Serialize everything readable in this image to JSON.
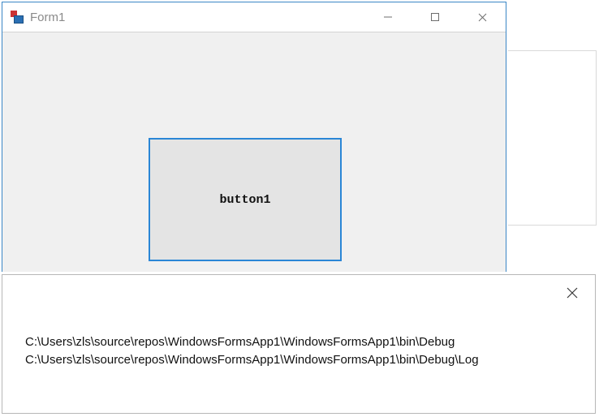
{
  "form": {
    "title": "Form1",
    "button_label": "button1"
  },
  "msgbox": {
    "line1": "C:\\Users\\zls\\source\\repos\\WindowsFormsApp1\\WindowsFormsApp1\\bin\\Debug",
    "line2": "C:\\Users\\zls\\source\\repos\\WindowsFormsApp1\\WindowsFormsApp1\\bin\\Debug\\Log"
  }
}
